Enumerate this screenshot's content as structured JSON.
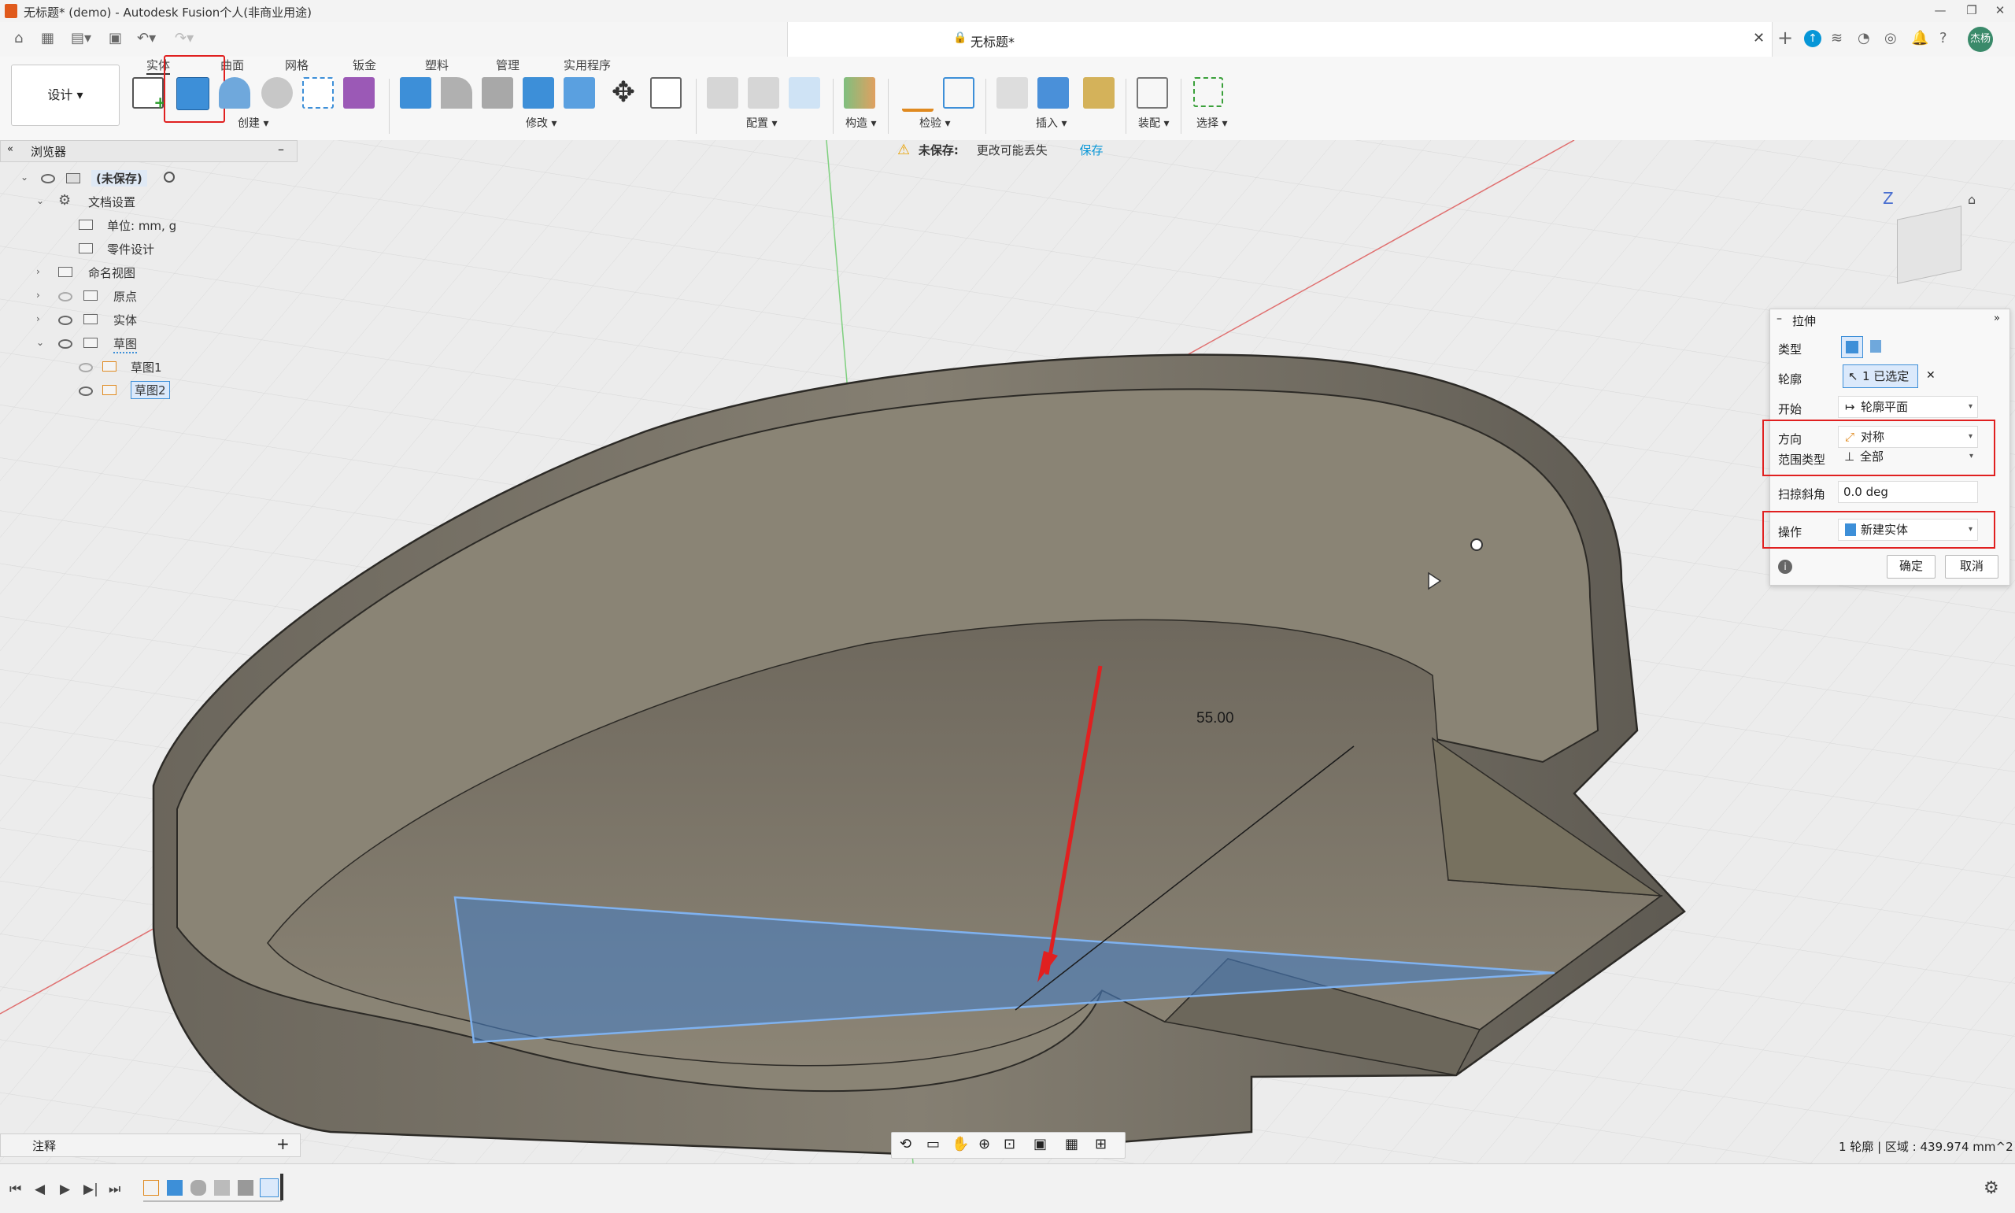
{
  "window": {
    "title": "无标题* (demo) - Autodesk Fusion个人(非商业用途)",
    "doc_tab": "无标题*",
    "user_initials": "杰杨"
  },
  "toolbar": {
    "workspace": "设计",
    "categories": [
      "实体",
      "曲面",
      "网格",
      "钣金",
      "塑料",
      "管理",
      "实用程序"
    ],
    "groups": [
      "创建",
      "修改",
      "配置",
      "构造",
      "检验",
      "插入",
      "装配",
      "选择"
    ]
  },
  "notice": {
    "label": "未保存:",
    "message": "更改可能丢失",
    "action": "保存"
  },
  "browser": {
    "title": "浏览器",
    "root": "(未保存)",
    "doc_settings": "文档设置",
    "units": "单位: mm, g",
    "part_design": "零件设计",
    "named_views": "命名视图",
    "origin": "原点",
    "bodies": "实体",
    "sketches": "草图",
    "sketch1": "草图1",
    "sketch2": "草图2"
  },
  "annotations_label": "注释",
  "viewport": {
    "dimension": "55.00",
    "status": "1 轮廓 | 区域 : 439.974 mm^2",
    "viewcube_axis": "Z"
  },
  "panel": {
    "title": "拉伸",
    "type_label": "类型",
    "profile_label": "轮廓",
    "profile_value": "1 已选定",
    "start_label": "开始",
    "start_value": "轮廓平面",
    "direction_label": "方向",
    "direction_value": "对称",
    "extent_label": "范围类型",
    "extent_value": "全部",
    "taper_label": "扫掠斜角",
    "taper_value": "0.0 deg",
    "operation_label": "操作",
    "operation_value": "新建实体",
    "ok": "确定",
    "cancel": "取消"
  },
  "colors": {
    "accent": "#0696d7",
    "highlight": "#e02020",
    "model": "#7a7466"
  }
}
